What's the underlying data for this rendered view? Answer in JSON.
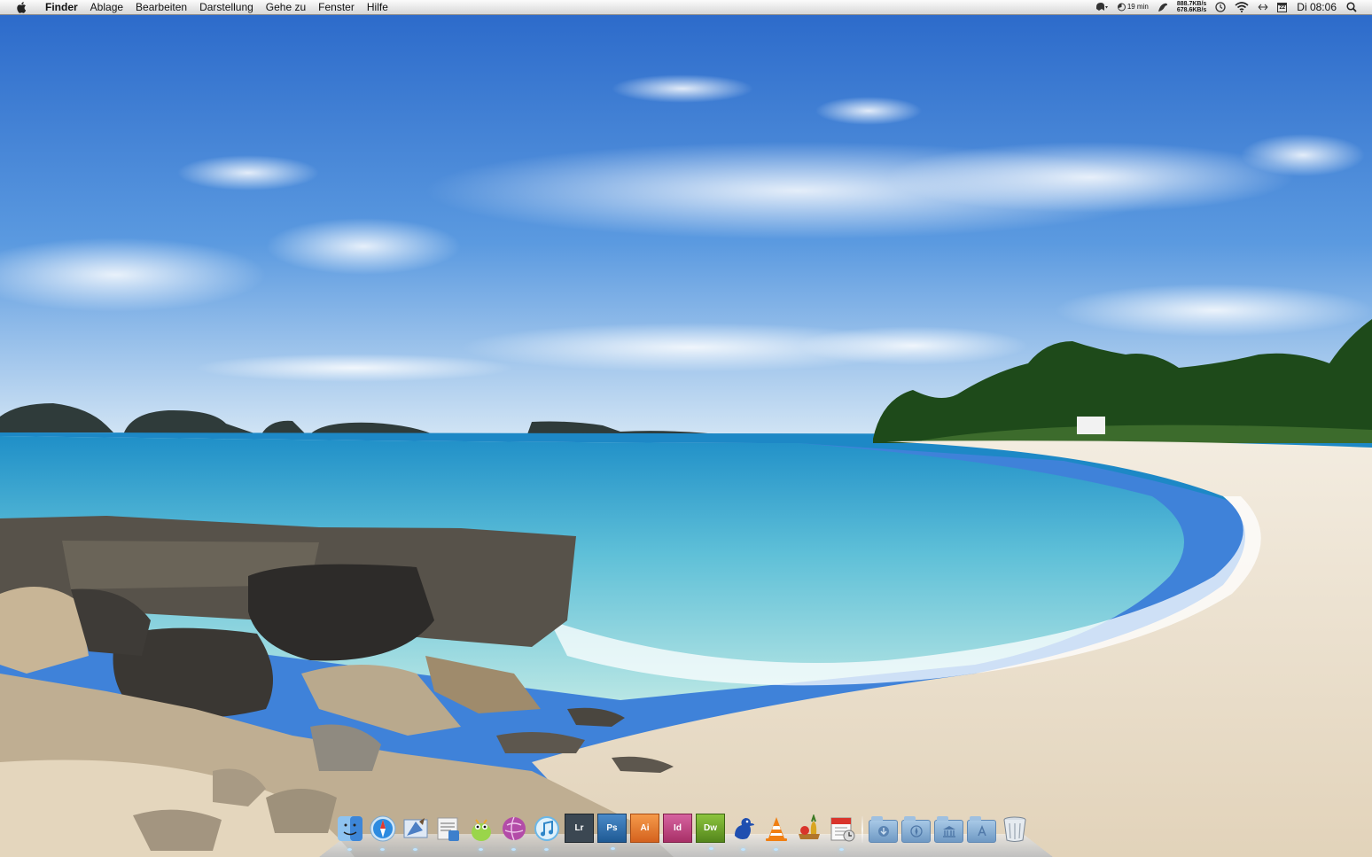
{
  "menubar": {
    "app_name": "Finder",
    "items": [
      "Ablage",
      "Bearbeiten",
      "Darstellung",
      "Gehe zu",
      "Fenster",
      "Hilfe"
    ],
    "battery_time": "19 min",
    "net_up": "888.7KB/s",
    "net_down": "678.6KB/s",
    "calendar_day": "22",
    "clock": "Di 08:06"
  },
  "dock": {
    "apps": [
      {
        "name": "Finder",
        "icon": "finder-icon",
        "label": "",
        "color": "#3d86d8"
      },
      {
        "name": "Safari",
        "icon": "safari-icon",
        "label": "",
        "color": "#2d8be0"
      },
      {
        "name": "Mail",
        "icon": "mail-icon",
        "label": "",
        "color": "#4c7fc4"
      },
      {
        "name": "Times",
        "icon": "times-icon",
        "label": "",
        "color": "#dcdcdc"
      },
      {
        "name": "Adium",
        "icon": "adium-icon",
        "label": "",
        "color": "#9ad54a"
      },
      {
        "name": "Camino",
        "icon": "globe-icon",
        "label": "",
        "color": "#b34ca8"
      },
      {
        "name": "iTunes",
        "icon": "itunes-icon",
        "label": "",
        "color": "#6ab7e8"
      },
      {
        "name": "Lightroom",
        "icon": "lightroom-icon",
        "label": "Lr",
        "color": "#3b4752"
      },
      {
        "name": "Photoshop",
        "icon": "photoshop-icon",
        "label": "Ps",
        "color": "#2f6aa6"
      },
      {
        "name": "Illustrator",
        "icon": "illustrator-icon",
        "label": "Ai",
        "color": "#e8742a"
      },
      {
        "name": "InDesign",
        "icon": "indesign-icon",
        "label": "Id",
        "color": "#c2407c"
      },
      {
        "name": "Dreamweaver",
        "icon": "dreamweaver-icon",
        "label": "Dw",
        "color": "#6a9d2a"
      },
      {
        "name": "Cyberduck",
        "icon": "duck-icon",
        "label": "",
        "color": "#1f4fb0"
      },
      {
        "name": "VLC",
        "icon": "vlc-cone-icon",
        "label": "",
        "color": "#f07f12"
      },
      {
        "name": "Fruit",
        "icon": "fruit-icon",
        "label": "",
        "color": "#d9a521"
      },
      {
        "name": "iCal Timer",
        "icon": "calendar-timer-icon",
        "label": "",
        "color": "#f2f2f2"
      }
    ],
    "folders": [
      {
        "name": "Downloads",
        "icon": "downloads-folder-icon"
      },
      {
        "name": "Applications",
        "icon": "applications-folder-icon"
      },
      {
        "name": "Library",
        "icon": "library-folder-icon"
      },
      {
        "name": "Apps",
        "icon": "appstore-folder-icon"
      }
    ],
    "trash": {
      "name": "Trash",
      "icon": "trash-icon"
    }
  },
  "colors": {
    "sky_top": "#2e6fcf",
    "sky_bottom": "#cfe3f4",
    "sea_deep": "#2b9ad0",
    "sea_shallow": "#9fd9e0",
    "sand": "#ece2cf",
    "trees": "#234f1c",
    "rocks": "#6e665b"
  }
}
